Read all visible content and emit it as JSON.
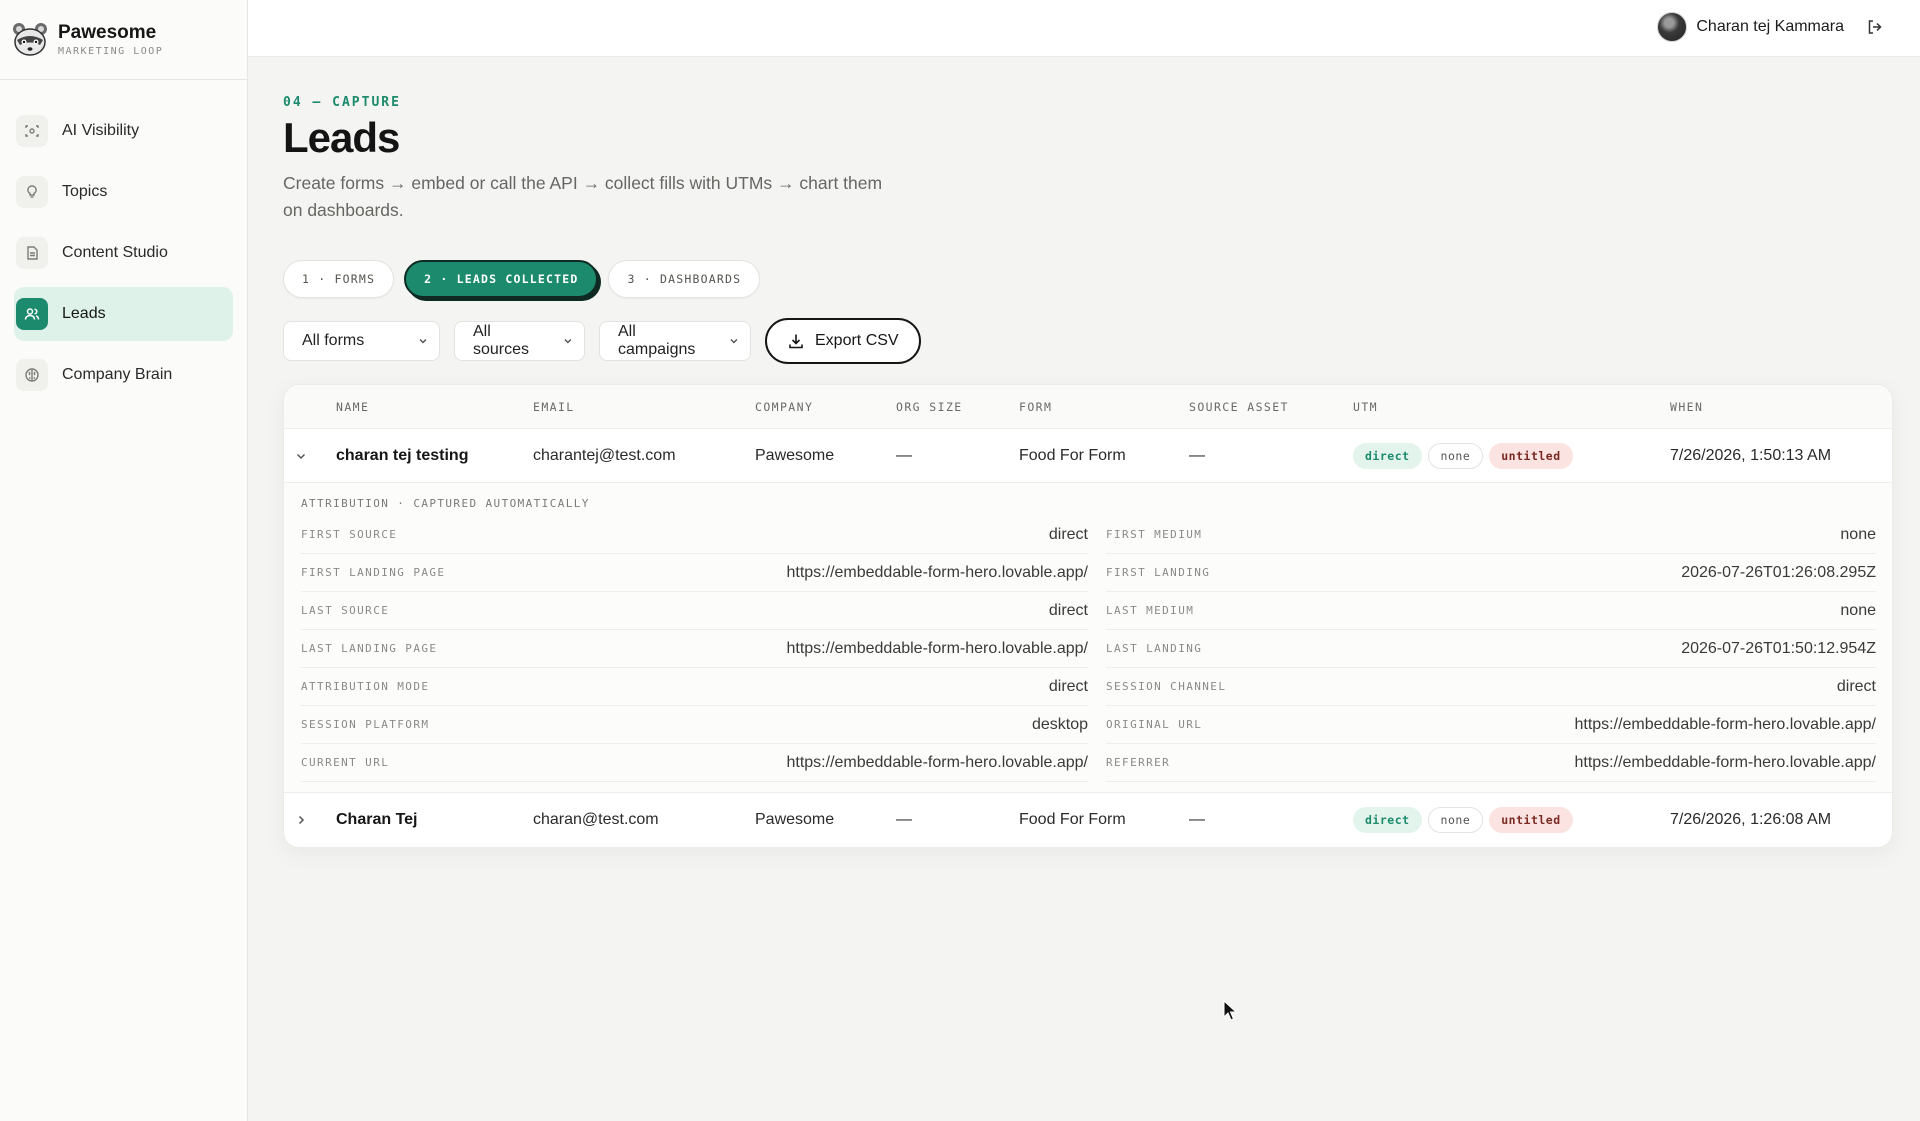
{
  "brand": {
    "name": "Pawesome",
    "subtitle": "MARKETING LOOP"
  },
  "sidebar": {
    "items": [
      {
        "label": "AI Visibility",
        "icon": "scan-eye-icon",
        "active": false
      },
      {
        "label": "Topics",
        "icon": "lightbulb-icon",
        "active": false
      },
      {
        "label": "Content Studio",
        "icon": "document-icon",
        "active": false
      },
      {
        "label": "Leads",
        "icon": "users-icon",
        "active": true
      },
      {
        "label": "Company Brain",
        "icon": "brain-icon",
        "active": false
      }
    ]
  },
  "topbar": {
    "user_name": "Charan tej Kammara",
    "logout_icon": "logout-icon"
  },
  "header": {
    "section_tag": "04 — CAPTURE",
    "title": "Leads",
    "description": "Create forms → embed or call the API → collect fills with UTMs → chart them on dashboards."
  },
  "steps": [
    {
      "label": "1 · FORMS",
      "active": false
    },
    {
      "label": "2 · LEADS COLLECTED",
      "active": true
    },
    {
      "label": "3 · DASHBOARDS",
      "active": false
    }
  ],
  "filters": {
    "forms": "All forms",
    "sources": "All sources",
    "campaigns": "All campaigns",
    "export_label": "Export CSV"
  },
  "table": {
    "columns": [
      "NAME",
      "EMAIL",
      "COMPANY",
      "ORG SIZE",
      "FORM",
      "SOURCE ASSET",
      "UTM",
      "WHEN"
    ],
    "rows": [
      {
        "name": "charan tej testing",
        "email": "charantej@test.com",
        "company": "Pawesome",
        "org_size": "—",
        "form": "Food For Form",
        "source_asset": "—",
        "utm": [
          "direct",
          "none",
          "untitled"
        ],
        "when": "7/26/2026, 1:50:13 AM",
        "expanded": true
      },
      {
        "name": "Charan Tej",
        "email": "charan@test.com",
        "company": "Pawesome",
        "org_size": "—",
        "form": "Food For Form",
        "source_asset": "—",
        "utm": [
          "direct",
          "none",
          "untitled"
        ],
        "when": "7/26/2026, 1:26:08 AM",
        "expanded": false
      }
    ]
  },
  "attribution": {
    "title": "ATTRIBUTION · CAPTURED AUTOMATICALLY",
    "left": [
      {
        "key": "FIRST SOURCE",
        "value": "direct"
      },
      {
        "key": "FIRST LANDING PAGE",
        "value": "https://embeddable-form-hero.lovable.app/"
      },
      {
        "key": "LAST SOURCE",
        "value": "direct"
      },
      {
        "key": "LAST LANDING PAGE",
        "value": "https://embeddable-form-hero.lovable.app/"
      },
      {
        "key": "ATTRIBUTION MODE",
        "value": "direct"
      },
      {
        "key": "SESSION PLATFORM",
        "value": "desktop"
      },
      {
        "key": "CURRENT URL",
        "value": "https://embeddable-form-hero.lovable.app/"
      }
    ],
    "right": [
      {
        "key": "FIRST MEDIUM",
        "value": "none"
      },
      {
        "key": "FIRST LANDING",
        "value": "2026-07-26T01:26:08.295Z"
      },
      {
        "key": "LAST MEDIUM",
        "value": "none"
      },
      {
        "key": "LAST LANDING",
        "value": "2026-07-26T01:50:12.954Z"
      },
      {
        "key": "SESSION CHANNEL",
        "value": "direct"
      },
      {
        "key": "ORIGINAL URL",
        "value": "https://embeddable-form-hero.lovable.app/"
      },
      {
        "key": "REFERRER",
        "value": "https://embeddable-form-hero.lovable.app/"
      }
    ]
  },
  "colors": {
    "accent": "#1c8a6c",
    "accent_light": "#dff2ea",
    "danger_light": "#fbe3e1"
  }
}
